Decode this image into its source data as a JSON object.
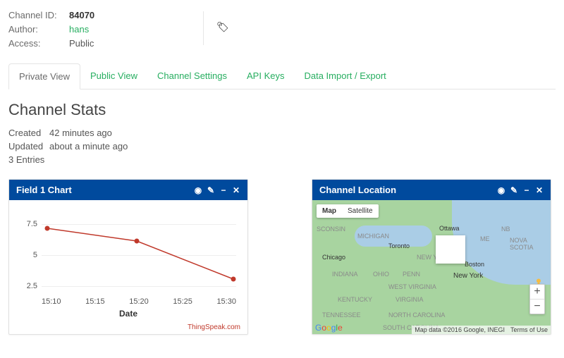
{
  "meta": {
    "channel_id_label": "Channel ID:",
    "channel_id": "84070",
    "author_label": "Author:",
    "author": "hans",
    "access_label": "Access:",
    "access": "Public"
  },
  "tabs": {
    "private": "Private View",
    "public": "Public View",
    "settings": "Channel Settings",
    "api": "API Keys",
    "import": "Data Import / Export"
  },
  "stats": {
    "heading": "Channel Stats",
    "created_label": "Created",
    "created": "42 minutes ago",
    "updated_label": "Updated",
    "updated": "about a minute ago",
    "entries": "3 Entries"
  },
  "panel_chart": {
    "title": "Field 1 Chart",
    "xaxis": "Date",
    "attribution": "ThingSpeak.com",
    "yticks": {
      "a": "7.5",
      "b": "5",
      "c": "2.5"
    },
    "xticks": {
      "a": "15:10",
      "b": "15:15",
      "c": "15:20",
      "d": "15:25",
      "e": "15:30"
    }
  },
  "panel_map": {
    "title": "Channel Location",
    "type_map": "Map",
    "type_sat": "Satellite",
    "footer_data": "Map data ©2016 Google, INEGI",
    "footer_terms": "Terms of Use",
    "labels": {
      "ottawa": "Ottawa",
      "toronto": "Toronto",
      "chicago": "Chicago",
      "newyork": "New York",
      "boston": "Boston",
      "michigan": "MICHIGAN",
      "ohio": "OHIO",
      "penn": "PENN",
      "indiana": "INDIANA",
      "wv": "WEST VIRGINIA",
      "va": "VIRGINIA",
      "tn": "TENNESSEE",
      "ky": "KENTUCKY",
      "nc": "NORTH CAROLINA",
      "sc": "SOUTH CAROLINA",
      "ns": "NOVA SCOTIA",
      "nb": "NB",
      "me": "ME",
      "sconsin": "SCONSIN",
      "nynj": "NEW YORK"
    }
  },
  "icons": {
    "eye": "◉",
    "pencil": "✎",
    "min": "−",
    "close": "✕",
    "tag": "🏷",
    "plus": "+",
    "minus": "−"
  },
  "chart_data": {
    "type": "line",
    "title": "Field 1 Chart",
    "xlabel": "Date",
    "ylabel": "",
    "ylim": [
      2.5,
      7.5
    ],
    "categories": [
      "15:10",
      "15:15",
      "15:20",
      "15:25",
      "15:30"
    ],
    "series": [
      {
        "name": "Field 1",
        "x": [
          "15:10",
          "15:20",
          "15:31"
        ],
        "y": [
          7.0,
          6.0,
          3.0
        ]
      }
    ]
  }
}
